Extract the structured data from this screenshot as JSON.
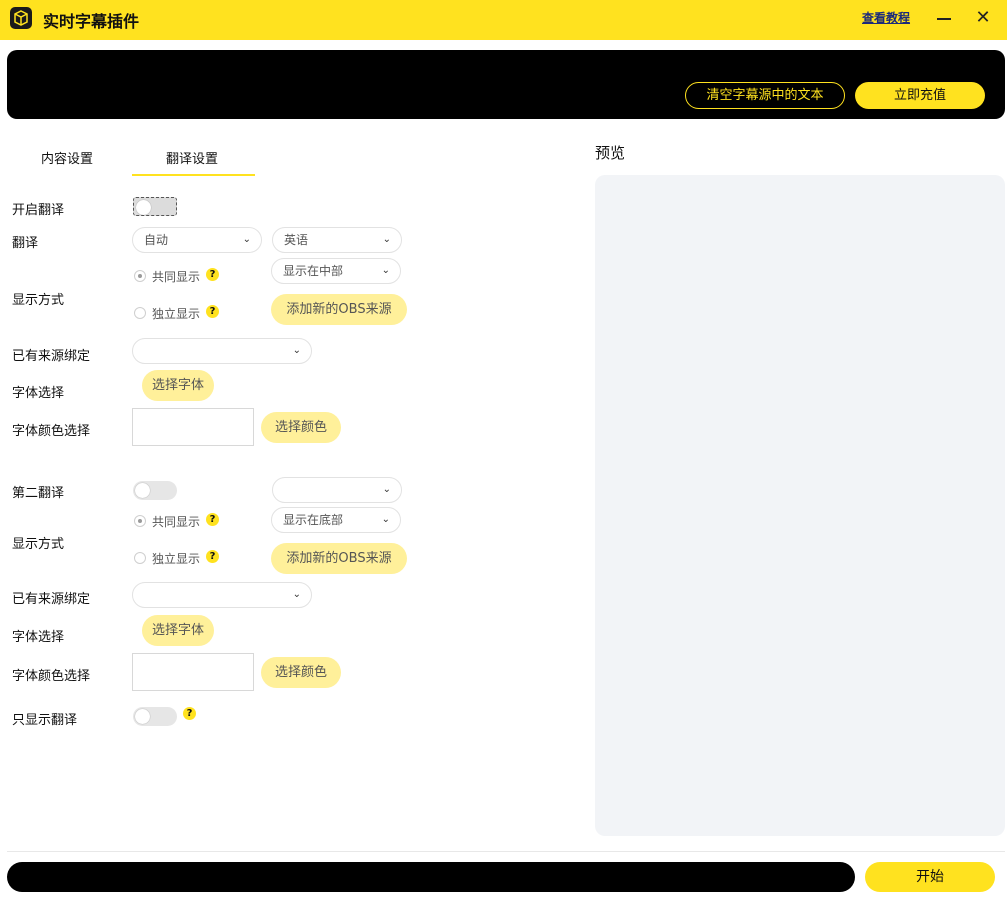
{
  "window": {
    "title": "实时字幕插件",
    "tutorial_link": "查看教程",
    "close_glyph": "✕"
  },
  "banner": {
    "clear_button": "清空字幕源中的文本",
    "recharge_button": "立即充值"
  },
  "tabs": [
    {
      "label": "内容设置",
      "active": false
    },
    {
      "label": "翻译设置",
      "active": true
    }
  ],
  "first_translation": {
    "enable_label": "开启翻译",
    "translate_label": "翻译",
    "source_lang": "自动",
    "target_lang": "英语",
    "display_label": "显示方式",
    "radio_joint": "共同显示",
    "radio_separate": "独立显示",
    "position_select": "显示在中部",
    "add_obs_button": "添加新的OBS来源",
    "bind_label": "已有来源绑定",
    "bind_select": "",
    "font_label": "字体选择",
    "font_button": "选择字体",
    "color_label": "字体颜色选择",
    "color_button": "选择颜色"
  },
  "second_translation": {
    "enable_label": "第二翻译",
    "lang_select": "",
    "display_label": "显示方式",
    "radio_joint": "共同显示",
    "radio_separate": "独立显示",
    "position_select": "显示在底部",
    "add_obs_button": "添加新的OBS来源",
    "bind_label": "已有来源绑定",
    "bind_select": "",
    "font_label": "字体选择",
    "font_button": "选择字体",
    "color_label": "字体颜色选择",
    "color_button": "选择颜色"
  },
  "only_translation_label": "只显示翻译",
  "help_glyph": "?",
  "chevron_glyph": "⌄",
  "preview": {
    "title": "预览"
  },
  "footer": {
    "start_button": "开始"
  },
  "colors": {
    "accent": "#ffe21f",
    "pill": "#fff09a",
    "banner": "#000000",
    "preview_bg": "#f2f4f7"
  }
}
